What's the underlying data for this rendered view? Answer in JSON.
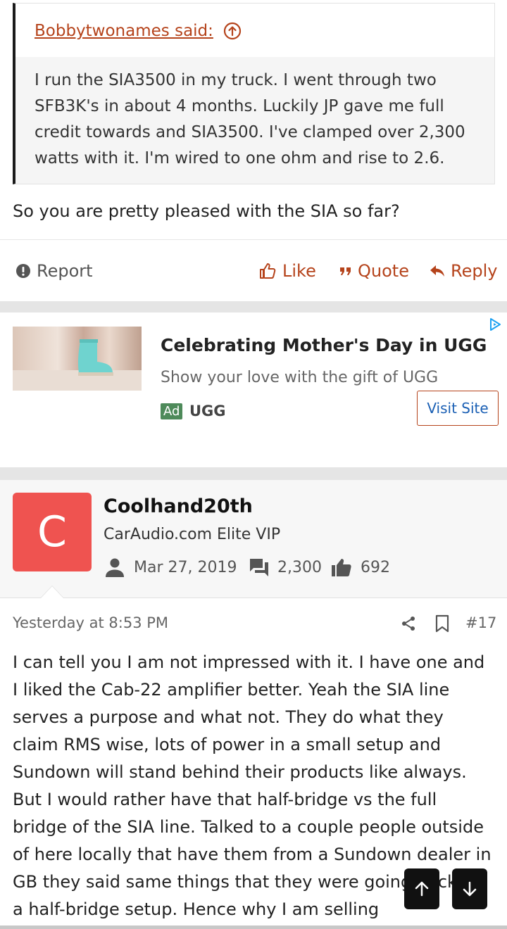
{
  "quote": {
    "author_label": "Bobbytwonames said:",
    "body": "I run the SIA3500 in my truck. I went through two SFB3K's in about 4 months. Luckily JP gave me full credit towards and SIA3500. I've clamped over 2,300 watts with it. I'm wired to one ohm and rise to 2.6."
  },
  "previous_post": {
    "tail_text": "So you are pretty pleased with the SIA so far?"
  },
  "actions": {
    "report": "Report",
    "like": "Like",
    "quote": "Quote",
    "reply": "Reply"
  },
  "ad": {
    "title": "Celebrating Mother's Day in UGG",
    "description": "Show your love with the gift of UGG",
    "badge": "Ad",
    "brand": "UGG",
    "cta": "Visit Site"
  },
  "user": {
    "avatar_letter": "C",
    "name": "Coolhand20th",
    "title": "CarAudio.com Elite VIP",
    "joined": "Mar 27, 2019",
    "messages": "2,300",
    "reactions": "692"
  },
  "post": {
    "date": "Yesterday at 8:53 PM",
    "number": "#17",
    "body": "I can tell you I am not impressed with it. I have one and I liked the Cab-22 amplifier better. Yeah the SIA line serves a purpose and what not. They do what they claim RMS wise, lots of power in a small setup and Sundown will stand behind their products like always. But I would rather have that half-bridge vs the full bridge of the SIA line. Talked to a couple people outside of here locally that have them from a Sundown dealer in GB they said same things that they were going back to a half-bridge setup. Hence why I am selling"
  },
  "colors": {
    "accent": "#b5431b",
    "avatar_bg": "#ef5350",
    "ad_badge": "#4e8a5a",
    "link_blue": "#1a5fb4"
  },
  "icons": {
    "quote_jump": "arrow-up-circle-icon",
    "report": "exclamation-circle-icon",
    "like": "thumbs-up-icon",
    "quote": "quote-marks-icon",
    "reply": "reply-arrow-icon",
    "joined": "person-icon",
    "messages": "chat-icon",
    "reactions": "thumbs-up-filled-icon",
    "share": "share-icon",
    "bookmark": "bookmark-icon",
    "scroll_up": "arrow-up-icon",
    "scroll_down": "arrow-down-icon"
  }
}
